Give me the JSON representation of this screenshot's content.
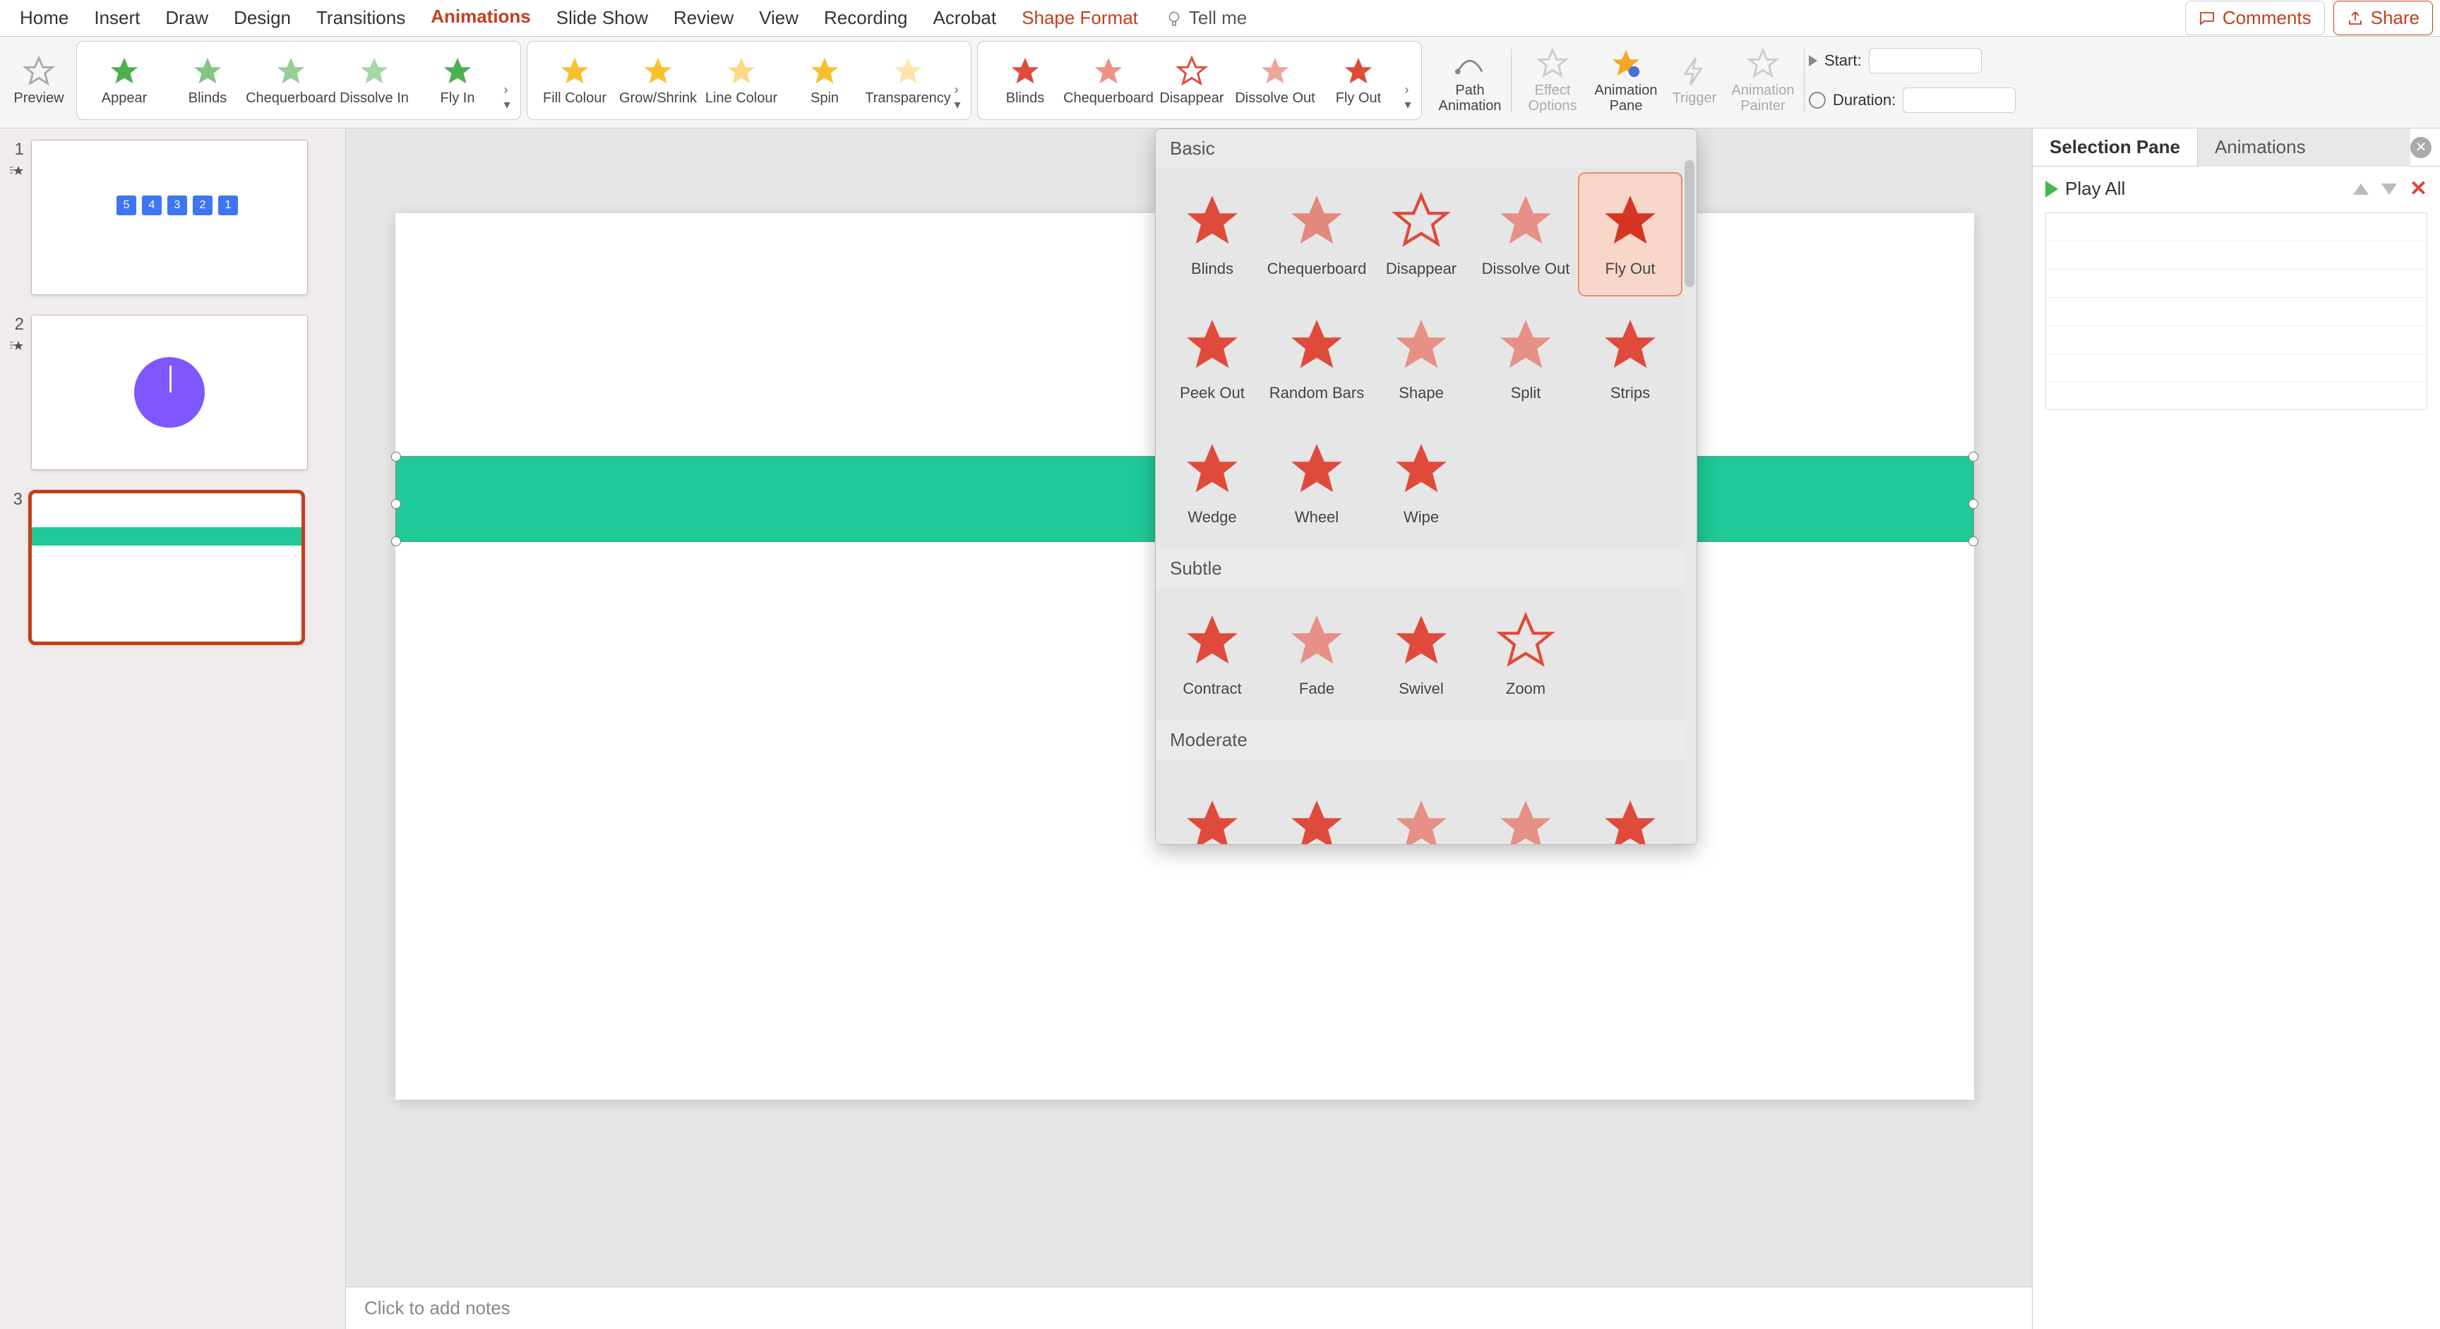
{
  "tabs": [
    "Home",
    "Insert",
    "Draw",
    "Design",
    "Transitions",
    "Animations",
    "Slide Show",
    "Review",
    "View",
    "Recording",
    "Acrobat",
    "Shape Format"
  ],
  "active_tab": "Animations",
  "tellme": "Tell me",
  "top_buttons": {
    "comments": "Comments",
    "share": "Share"
  },
  "ribbon": {
    "preview": "Preview",
    "entrance": [
      "Appear",
      "Blinds",
      "Chequerboard",
      "Dissolve In",
      "Fly In"
    ],
    "emphasis": [
      "Fill Colour",
      "Grow/Shrink",
      "Line Colour",
      "Spin",
      "Transparency"
    ],
    "exit": [
      "Blinds",
      "Chequerboard",
      "Disappear",
      "Dissolve Out",
      "Fly Out"
    ],
    "path_animation": "Path Animation",
    "effect_options": "Effect Options",
    "animation_pane": "Animation Pane",
    "trigger": "Trigger",
    "animation_painter": "Animation Painter",
    "timing": {
      "start_label": "Start:",
      "duration_label": "Duration:",
      "start_value": "",
      "duration_value": ""
    }
  },
  "popup": {
    "sections": [
      {
        "title": "Basic",
        "items": [
          "Blinds",
          "Chequerboard",
          "Disappear",
          "Dissolve Out",
          "Fly Out",
          "Peek Out",
          "Random Bars",
          "Shape",
          "Split",
          "Strips",
          "Wedge",
          "Wheel",
          "Wipe"
        ],
        "selected": "Fly Out"
      },
      {
        "title": "Subtle",
        "items": [
          "Contract",
          "Fade",
          "Swivel",
          "Zoom"
        ]
      },
      {
        "title": "Moderate",
        "items": [
          "",
          "",
          "",
          "",
          ""
        ]
      }
    ]
  },
  "slides": {
    "thumbs": [
      {
        "num": "1",
        "chips": [
          "5",
          "4",
          "3",
          "2",
          "1"
        ]
      },
      {
        "num": "2"
      },
      {
        "num": "3",
        "selected": true
      }
    ]
  },
  "notes_placeholder": "Click to add notes",
  "panes": {
    "selection": "Selection Pane",
    "animations": "Animations",
    "play_all": "Play All"
  }
}
